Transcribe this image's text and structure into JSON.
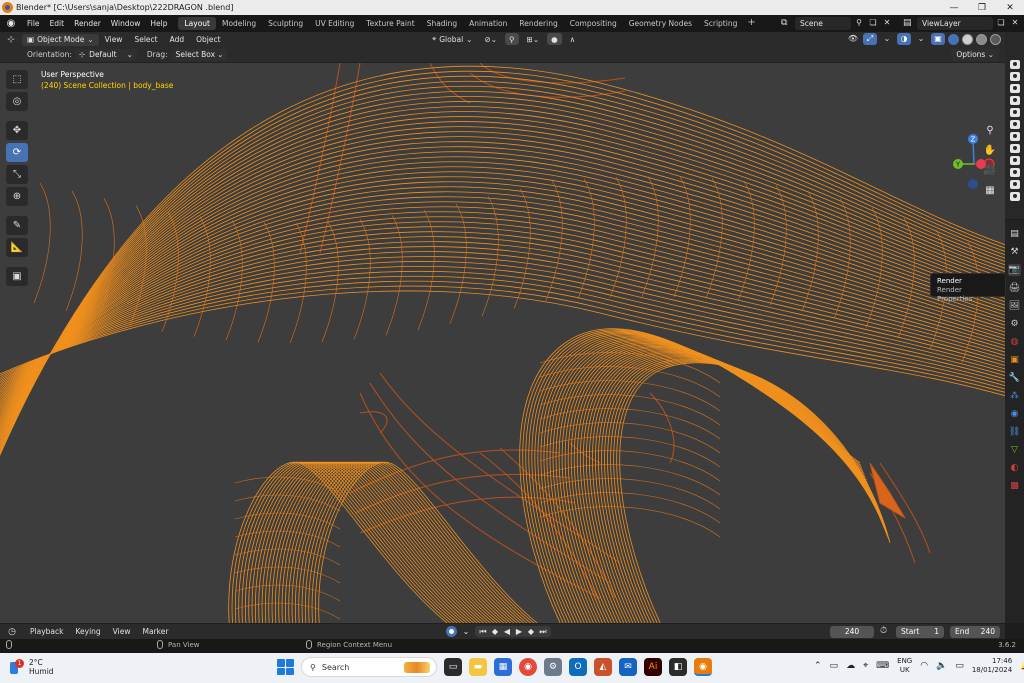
{
  "window": {
    "title": "Blender* [C:\\Users\\sanja\\Desktop\\222DRAGON .blend]",
    "controls": [
      "—",
      "❐",
      "✕"
    ]
  },
  "menubar": {
    "menus": [
      "File",
      "Edit",
      "Render",
      "Window",
      "Help"
    ],
    "workspaces": [
      "Layout",
      "Modeling",
      "Sculpting",
      "UV Editing",
      "Texture Paint",
      "Shading",
      "Animation",
      "Rendering",
      "Compositing",
      "Geometry Nodes",
      "Scripting"
    ],
    "active_workspace": "Layout",
    "scene": "Scene",
    "view_layer": "ViewLayer"
  },
  "viewport_header": {
    "mode": "Object Mode",
    "menus": [
      "View",
      "Select",
      "Add",
      "Object"
    ],
    "transform_orientation": "Global"
  },
  "tool_settings": {
    "orientation_label": "Orientation:",
    "orientation_value": "Default",
    "drag_label": "Drag:",
    "drag_value": "Select Box",
    "options_label": "Options"
  },
  "viewport": {
    "view_name": "User Perspective",
    "collection_info": "(240) Scene Collection | body_base",
    "wire_color": "#f0901e",
    "wire_dark": "#c4531a",
    "background": "#3d3d3d"
  },
  "gizmo": {
    "z_label": "Z",
    "y_label": "Y",
    "x_color": "#e2404e",
    "y_color": "#6fbf2c",
    "z_color": "#3d80e0"
  },
  "tooltip": {
    "title": "Render",
    "description": "Render Properties"
  },
  "timeline": {
    "menus": [
      "Playback",
      "Keying",
      "View",
      "Marker"
    ],
    "current_frame": "240",
    "start_label": "Start",
    "start_value": "1",
    "end_label": "End",
    "end_value": "240"
  },
  "statusbar": {
    "left_hint": "Pan View",
    "right_hint": "Region Context Menu",
    "version": "3.6.2"
  },
  "taskbar": {
    "temperature": "2°C",
    "weather_desc": "Humid",
    "notification_count": "1",
    "search_placeholder": "Search",
    "lang_line1": "ENG",
    "lang_line2": "UK",
    "time": "17:46",
    "date": "18/01/2024"
  }
}
